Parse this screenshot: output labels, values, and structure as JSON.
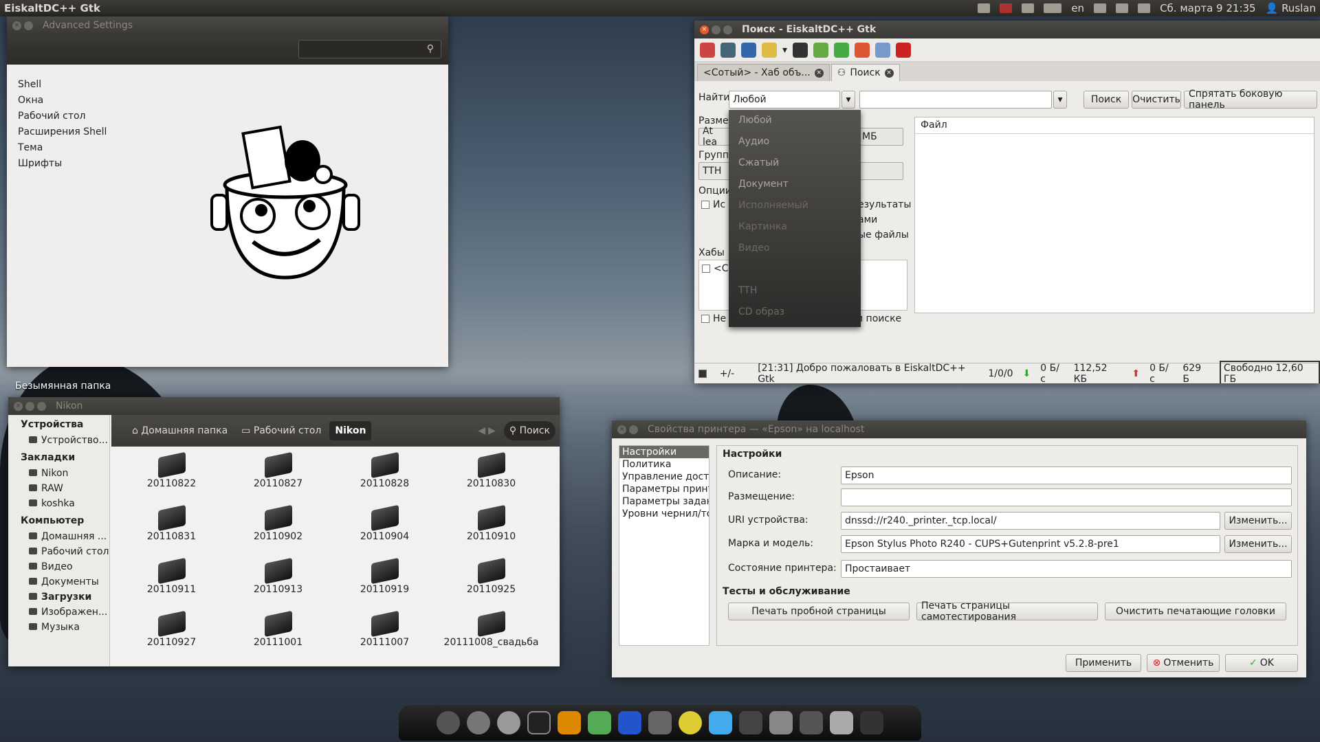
{
  "panel": {
    "app": "EiskaltDC++ Gtk",
    "lang": "en",
    "datetime": "Сб. марта  9 21:35",
    "user": "Ruslan"
  },
  "adv": {
    "title": "Advanced Settings",
    "items": [
      "Shell",
      "Окна",
      "Рабочий стол",
      "Расширения Shell",
      "Тема",
      "Шрифты"
    ]
  },
  "desktop": {
    "folder": "Безымянная папка"
  },
  "dc": {
    "title": "Поиск - EiskaltDC++ Gtk",
    "tabs": [
      "<Сотый> - Хаб объ...",
      "Поиск"
    ],
    "find_label": "Найти",
    "type_value": "Любой",
    "search_btn": "Поиск",
    "clear_btn": "Очистить",
    "hide_btn": "Спрятать боковую панель",
    "size_label": "Разме",
    "size_value": "At lea",
    "unit": "МБ",
    "group_label": "Группи",
    "group_value": "TTH",
    "options_label": "Опции",
    "opt1": "Ис",
    "opt1b": "езультаты",
    "opt2": "ами",
    "opt3": "ые файлы",
    "hubs_label": "Хабы",
    "hub1": "<С",
    "bottom_opt": "Не",
    "bottom_opt2": "и поиске",
    "file_col": "Файл",
    "dropdown": [
      "Любой",
      "Аудио",
      "Сжатый",
      "Документ",
      "Исполняемый",
      "Картинка",
      "Видео",
      "",
      "TTH",
      "CD образ"
    ],
    "status": {
      "pm": "+/-",
      "msg": "[21:31] Добро пожаловать в EiskaltDC++ Gtk",
      "slots": "1/0/0",
      "down": "0 Б/с",
      "downtotal": "112,52 КБ",
      "up": "0 Б/с",
      "uptotal": "629 Б",
      "free": "Свободно 12,60 ГБ"
    }
  },
  "nik": {
    "title": "Nikon",
    "devices": "Устройства",
    "device1": "Устройство...",
    "bookmarks": "Закладки",
    "bm": [
      "Nikon",
      "RAW",
      "koshka"
    ],
    "computer": "Компьютер",
    "comp": [
      "Домашняя ...",
      "Рабочий стол",
      "Видео",
      "Документы",
      "Загрузки",
      "Изображен...",
      "Музыка"
    ],
    "crumbs": [
      "Домашняя папка",
      "Рабочий стол",
      "Nikon"
    ],
    "search": "Поиск",
    "folders": [
      "20110822",
      "20110827",
      "20110828",
      "20110830",
      "20110831",
      "20110902",
      "20110904",
      "20110910",
      "20110911",
      "20110913",
      "20110919",
      "20110925",
      "20110927",
      "20111001",
      "20111007",
      "20111008_свадьба"
    ]
  },
  "pr": {
    "title": "Свойства принтера — «Epson» на localhost",
    "list": [
      "Настройки",
      "Политика",
      "Управление досту",
      "Параметры принт",
      "Параметры задан",
      "Уровни чернил/то"
    ],
    "section1": "Настройки",
    "desc_l": "Описание:",
    "desc_v": "Epson",
    "loc_l": "Размещение:",
    "loc_v": "",
    "uri_l": "URI устройства:",
    "uri_v": "dnssd://r240._printer._tcp.local/",
    "model_l": "Марка и модель:",
    "model_v": "Epson Stylus Photo R240 - CUPS+Gutenprint v5.2.8-pre1",
    "state_l": "Состояние принтера:",
    "state_v": "Простаивает",
    "change": "Изменить...",
    "section2": "Тесты и обслуживание",
    "test1": "Печать пробной страницы",
    "test2": "Печать страницы самотестирования",
    "test3": "Очистить печатающие головки",
    "apply": "Применить",
    "cancel": "Отменить",
    "ok": "OK"
  }
}
